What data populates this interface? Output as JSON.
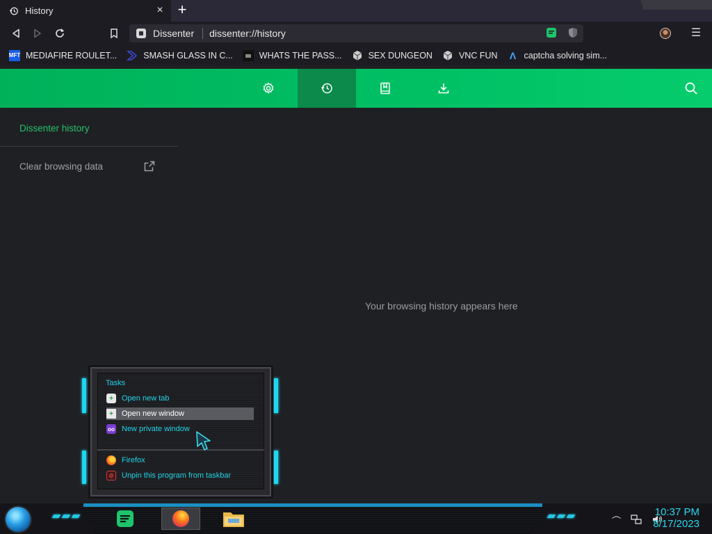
{
  "browser": {
    "tab": {
      "title": "History",
      "close": "×"
    },
    "new_tab": "+",
    "omnibox": {
      "site_chip": "Dissenter",
      "url": "dissenter://history"
    },
    "menu": "☰"
  },
  "bookmarks": [
    {
      "label": "MEDIAFIRE ROULET...",
      "icon": "mediafire-icon",
      "icon_text": "MFT",
      "color": "#1a5ee8"
    },
    {
      "label": "SMASH GLASS IN C...",
      "icon": "chevron-brand-icon",
      "icon_text": "",
      "color": "#3a4bd6"
    },
    {
      "label": "WHATS THE PASS...",
      "icon": "dark-site-icon",
      "icon_text": "",
      "color": "#111111"
    },
    {
      "label": "SEX DUNGEON",
      "icon": "cube-icon",
      "icon_text": "",
      "color": "#cccccc"
    },
    {
      "label": "VNC FUN",
      "icon": "cube-icon",
      "icon_text": "",
      "color": "#cccccc"
    },
    {
      "label": "captcha solving sim...",
      "icon": "lambda-icon",
      "icon_text": "Λ",
      "color": "#3fa8ff"
    }
  ],
  "header": {
    "tabs": [
      {
        "name": "settings",
        "icon": "gear-icon",
        "active": false
      },
      {
        "name": "history",
        "icon": "history-icon",
        "active": true
      },
      {
        "name": "bookmarks",
        "icon": "bookmark-icon",
        "active": false
      },
      {
        "name": "downloads",
        "icon": "download-icon",
        "active": false
      }
    ],
    "accent": "#00c064"
  },
  "sidebar": {
    "title": "Dissenter history",
    "clear_link": "Clear browsing data"
  },
  "main": {
    "empty_message": "Your browsing history appears here"
  },
  "jumplist": {
    "heading": "Tasks",
    "tasks": [
      {
        "label": "Open new tab",
        "icon": "new-tab-icon"
      },
      {
        "label": "Open new window",
        "icon": "new-window-icon"
      },
      {
        "label": "New private window",
        "icon": "private-window-icon"
      }
    ],
    "pinned": [
      {
        "label": "Firefox",
        "icon": "firefox-icon"
      },
      {
        "label": "Unpin this program from taskbar",
        "icon": "unpin-icon"
      }
    ]
  },
  "taskbar": {
    "time": "10:37 PM",
    "date": "8/17/2023"
  }
}
